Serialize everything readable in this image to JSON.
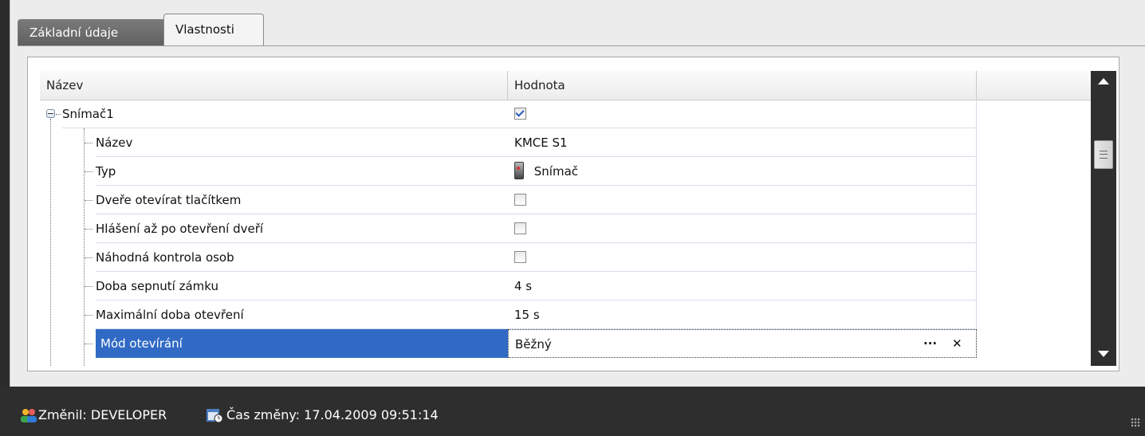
{
  "tabs": [
    {
      "label": "Základní údaje",
      "active": false
    },
    {
      "label": "Vlastnosti",
      "active": true
    }
  ],
  "grid": {
    "columns": [
      "Název",
      "Hodnota"
    ],
    "root": {
      "name": "Snímač1",
      "checked": true
    },
    "rows": [
      {
        "name": "Název",
        "value": "KMCE S1",
        "kind": "text"
      },
      {
        "name": "Typ",
        "value": "Snímač",
        "kind": "icon-text",
        "icon": "reader-device-icon"
      },
      {
        "name": "Dveře otevírat tlačítkem",
        "checked": false,
        "kind": "checkbox"
      },
      {
        "name": "Hlášení až po otevření dveří",
        "checked": false,
        "kind": "checkbox"
      },
      {
        "name": "Náhodná kontrola osob",
        "checked": false,
        "kind": "checkbox"
      },
      {
        "name": "Doba sepnutí zámku",
        "value": "4 s",
        "kind": "text"
      },
      {
        "name": "Maximální doba otevření",
        "value": "15 s",
        "kind": "text"
      },
      {
        "name": "Mód otevírání",
        "value": "Běžný",
        "kind": "editor",
        "selected": true
      }
    ],
    "editor_buttons": {
      "ellipsis": "···",
      "clear": "✕"
    }
  },
  "status": {
    "changed_by": "Změnil: DEVELOPER",
    "changed_at": "Čas změny: 17.04.2009 09:51:14"
  },
  "colors": {
    "selection": "#316ac5",
    "statusbar": "#2e2e2e",
    "scrollbar": "#2f2f2f"
  }
}
